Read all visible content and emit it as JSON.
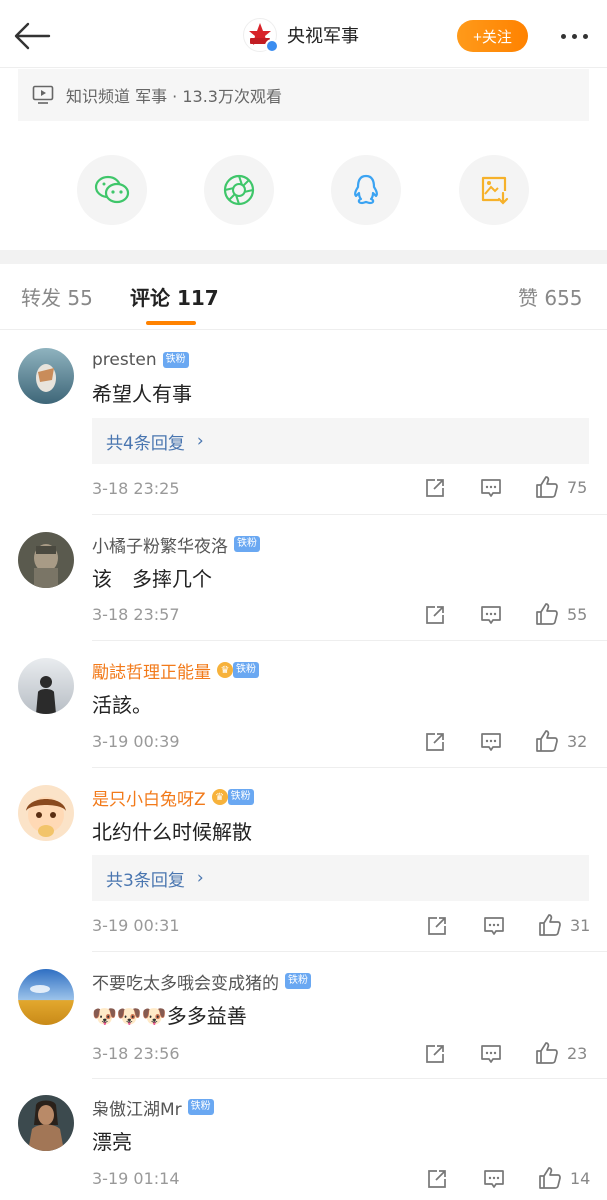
{
  "header": {
    "channel_name": "央视军事",
    "follow_label": "+关注"
  },
  "video_info": {
    "text": "知识频道 军事 · 13.3万次观看"
  },
  "share": {
    "icons": [
      "wechat-icon",
      "moments-icon",
      "qq-icon",
      "save-image-icon"
    ],
    "colors": {
      "wechat": "#3fc66a",
      "moments": "#3fc66a",
      "qq": "#3ba3f2",
      "save": "#f6b12a"
    }
  },
  "tabs": {
    "repost": "转发 55",
    "comments": "评论 117",
    "likes": "赞 655"
  },
  "colors": {
    "accent": "#ff8200",
    "link": "#4a76b0",
    "badge": "#6aa8f2"
  },
  "comments": [
    {
      "name": "presten",
      "badge": "铁粉",
      "text": "希望人有事",
      "reply": "共4条回复",
      "time": "3-18 23:25",
      "likes": "75"
    },
    {
      "name": "小橘子粉繁华夜洛",
      "badge": "铁粉",
      "text": "该　多摔几个",
      "time": "3-18 23:57",
      "likes": "55"
    },
    {
      "name": "勵誌哲理正能量",
      "badge": "铁粉",
      "text": "活該。",
      "time": "3-19 00:39",
      "likes": "32"
    },
    {
      "name": "是只小白兔呀Z",
      "badge": "铁粉",
      "text": "北约什么时候解散",
      "reply": "共3条回复",
      "time": "3-19 00:31",
      "likes": "31"
    },
    {
      "name": "不要吃太多哦会变成猪的",
      "badge": "铁粉",
      "emoji": "🐶🐶🐶",
      "text": "多多益善",
      "time": "3-18 23:56",
      "likes": "23"
    },
    {
      "name": "枭傲江湖Mr",
      "badge": "铁粉",
      "text": "漂亮",
      "time": "3-19 01:14",
      "likes": "14"
    }
  ]
}
